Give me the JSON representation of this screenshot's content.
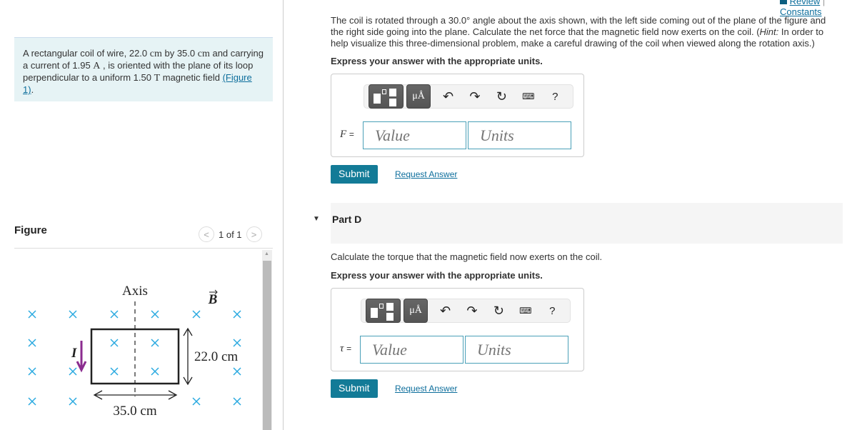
{
  "header": {
    "review": "Review",
    "separator": "|",
    "constants": "Constants"
  },
  "problem": {
    "intro_1": "A rectangular coil of wire, 22.0 ",
    "unit_cm": "cm",
    "intro_2": " by 35.0 ",
    "intro_3": " and carrying a current of 1.95 ",
    "unit_A": "A",
    "intro_4": " , is oriented with the plane of its loop perpendicular to a uniform 1.50 ",
    "unit_T": "T",
    "intro_5": " magnetic field ",
    "figure_link": "(Figure 1)",
    "intro_6": "."
  },
  "figure": {
    "heading": "Figure",
    "pager": "1 of 1",
    "prev": "<",
    "next": ">",
    "axis_label": "Axis",
    "b_label": "B",
    "current_label": "I",
    "height_label": "22.0 cm",
    "width_label": "35.0 cm",
    "colors": {
      "cross": "#29a9e0",
      "arrow": "#8b2c8f"
    }
  },
  "part_c": {
    "question": "The coil is rotated through a 30.0° angle about the axis shown, with the left side coming out of the plane of the figure and the right side going into the plane. Calculate the net force that the magnetic field now exerts on the coil. (",
    "hint_label": "Hint:",
    "hint": " In order to help visualize this three-dimensional problem, make a careful drawing of the coil when viewed along the rotation axis.)",
    "instruction": "Express your answer with the appropriate units.",
    "var": "F",
    "eq": "=",
    "value_placeholder": "Value",
    "units_placeholder": "Units",
    "submit": "Submit",
    "request": "Request Answer"
  },
  "part_d": {
    "title": "Part D",
    "question": "Calculate the torque that the magnetic field now exerts on the coil.",
    "instruction": "Express your answer with the appropriate units.",
    "var": "τ",
    "eq": "=",
    "value_placeholder": "Value",
    "units_placeholder": "Units",
    "submit": "Submit",
    "request": "Request Answer"
  },
  "toolbar": {
    "units_btn": "μÅ",
    "help": "?",
    "icons": [
      "templates-icon",
      "units-icon",
      "undo-icon",
      "redo-icon",
      "reset-icon",
      "keyboard-icon",
      "help-icon"
    ]
  },
  "colors": {
    "accent": "#137b97",
    "link": "#0d6e9c",
    "intro_bg": "#e6f3f5"
  }
}
